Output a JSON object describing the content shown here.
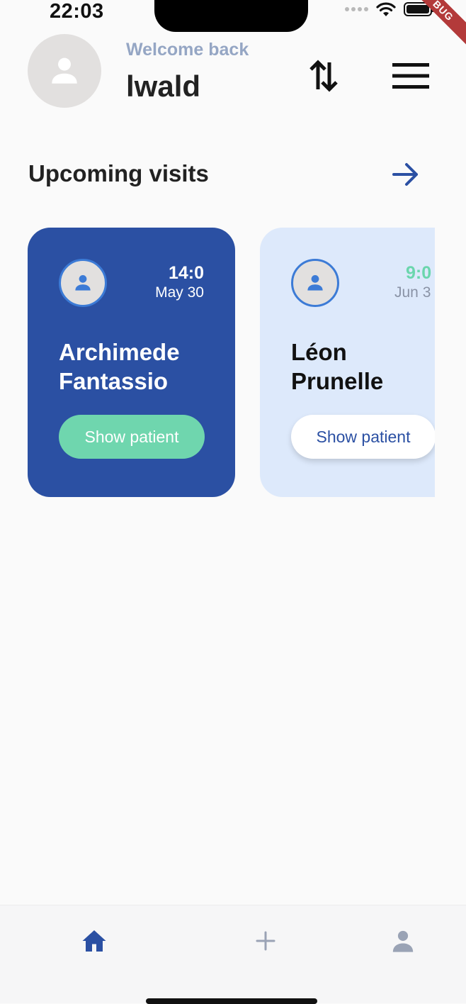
{
  "status_bar": {
    "time": "22:03",
    "debug_label": "BUG"
  },
  "header": {
    "welcome": "Welcome back",
    "username": "lwald",
    "sort_icon": "swap-vertical-icon",
    "menu_icon": "hamburger-menu-icon"
  },
  "upcoming": {
    "title": "Upcoming visits",
    "see_all_icon": "arrow-right-icon",
    "visits": [
      {
        "time": "14:0",
        "date": "May 30",
        "first_name": "Archimede",
        "last_name": "Fantassio",
        "button": "Show patient"
      },
      {
        "time": "9:0",
        "date": "Jun 3",
        "first_name": "Léon",
        "last_name": "Prunelle",
        "button": "Show patient"
      }
    ]
  },
  "bottom_nav": {
    "items": [
      {
        "icon": "home-icon",
        "active": true
      },
      {
        "icon": "plus-icon",
        "active": false
      },
      {
        "icon": "person-icon",
        "active": false
      }
    ]
  },
  "colors": {
    "primary": "#2b50a3",
    "accent_green": "#6fd6ae",
    "card_light": "#dde9fb",
    "muted_label": "#95a6c4"
  }
}
